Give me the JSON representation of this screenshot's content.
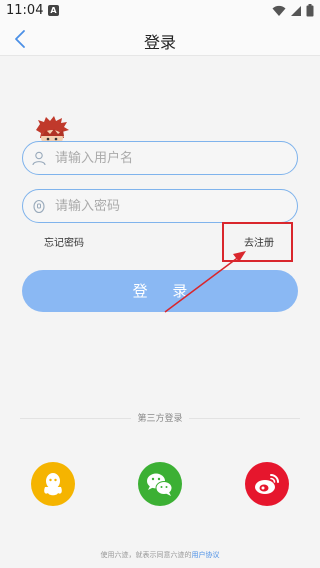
{
  "status_bar": {
    "time": "11:04",
    "notification_badge": "A"
  },
  "nav": {
    "title": "登录"
  },
  "form": {
    "username_placeholder": "请输入用户名",
    "password_placeholder": "请输入密码",
    "forgot_password": "忘记密码",
    "register": "去注册",
    "login_button": "登 录"
  },
  "third_party": {
    "title": "第三方登录",
    "providers": [
      "qq-icon",
      "wechat-icon",
      "weibo-icon"
    ]
  },
  "footer": {
    "agreement_prefix": "使用六迹，就表示同意六迹的",
    "agreement_link": "用户协议"
  },
  "colors": {
    "accent": "#7fb3ec",
    "button": "#8ab8f3",
    "annotation": "#d9262c",
    "qq": "#f5b400",
    "wechat": "#3cb034",
    "weibo": "#e6162d"
  }
}
